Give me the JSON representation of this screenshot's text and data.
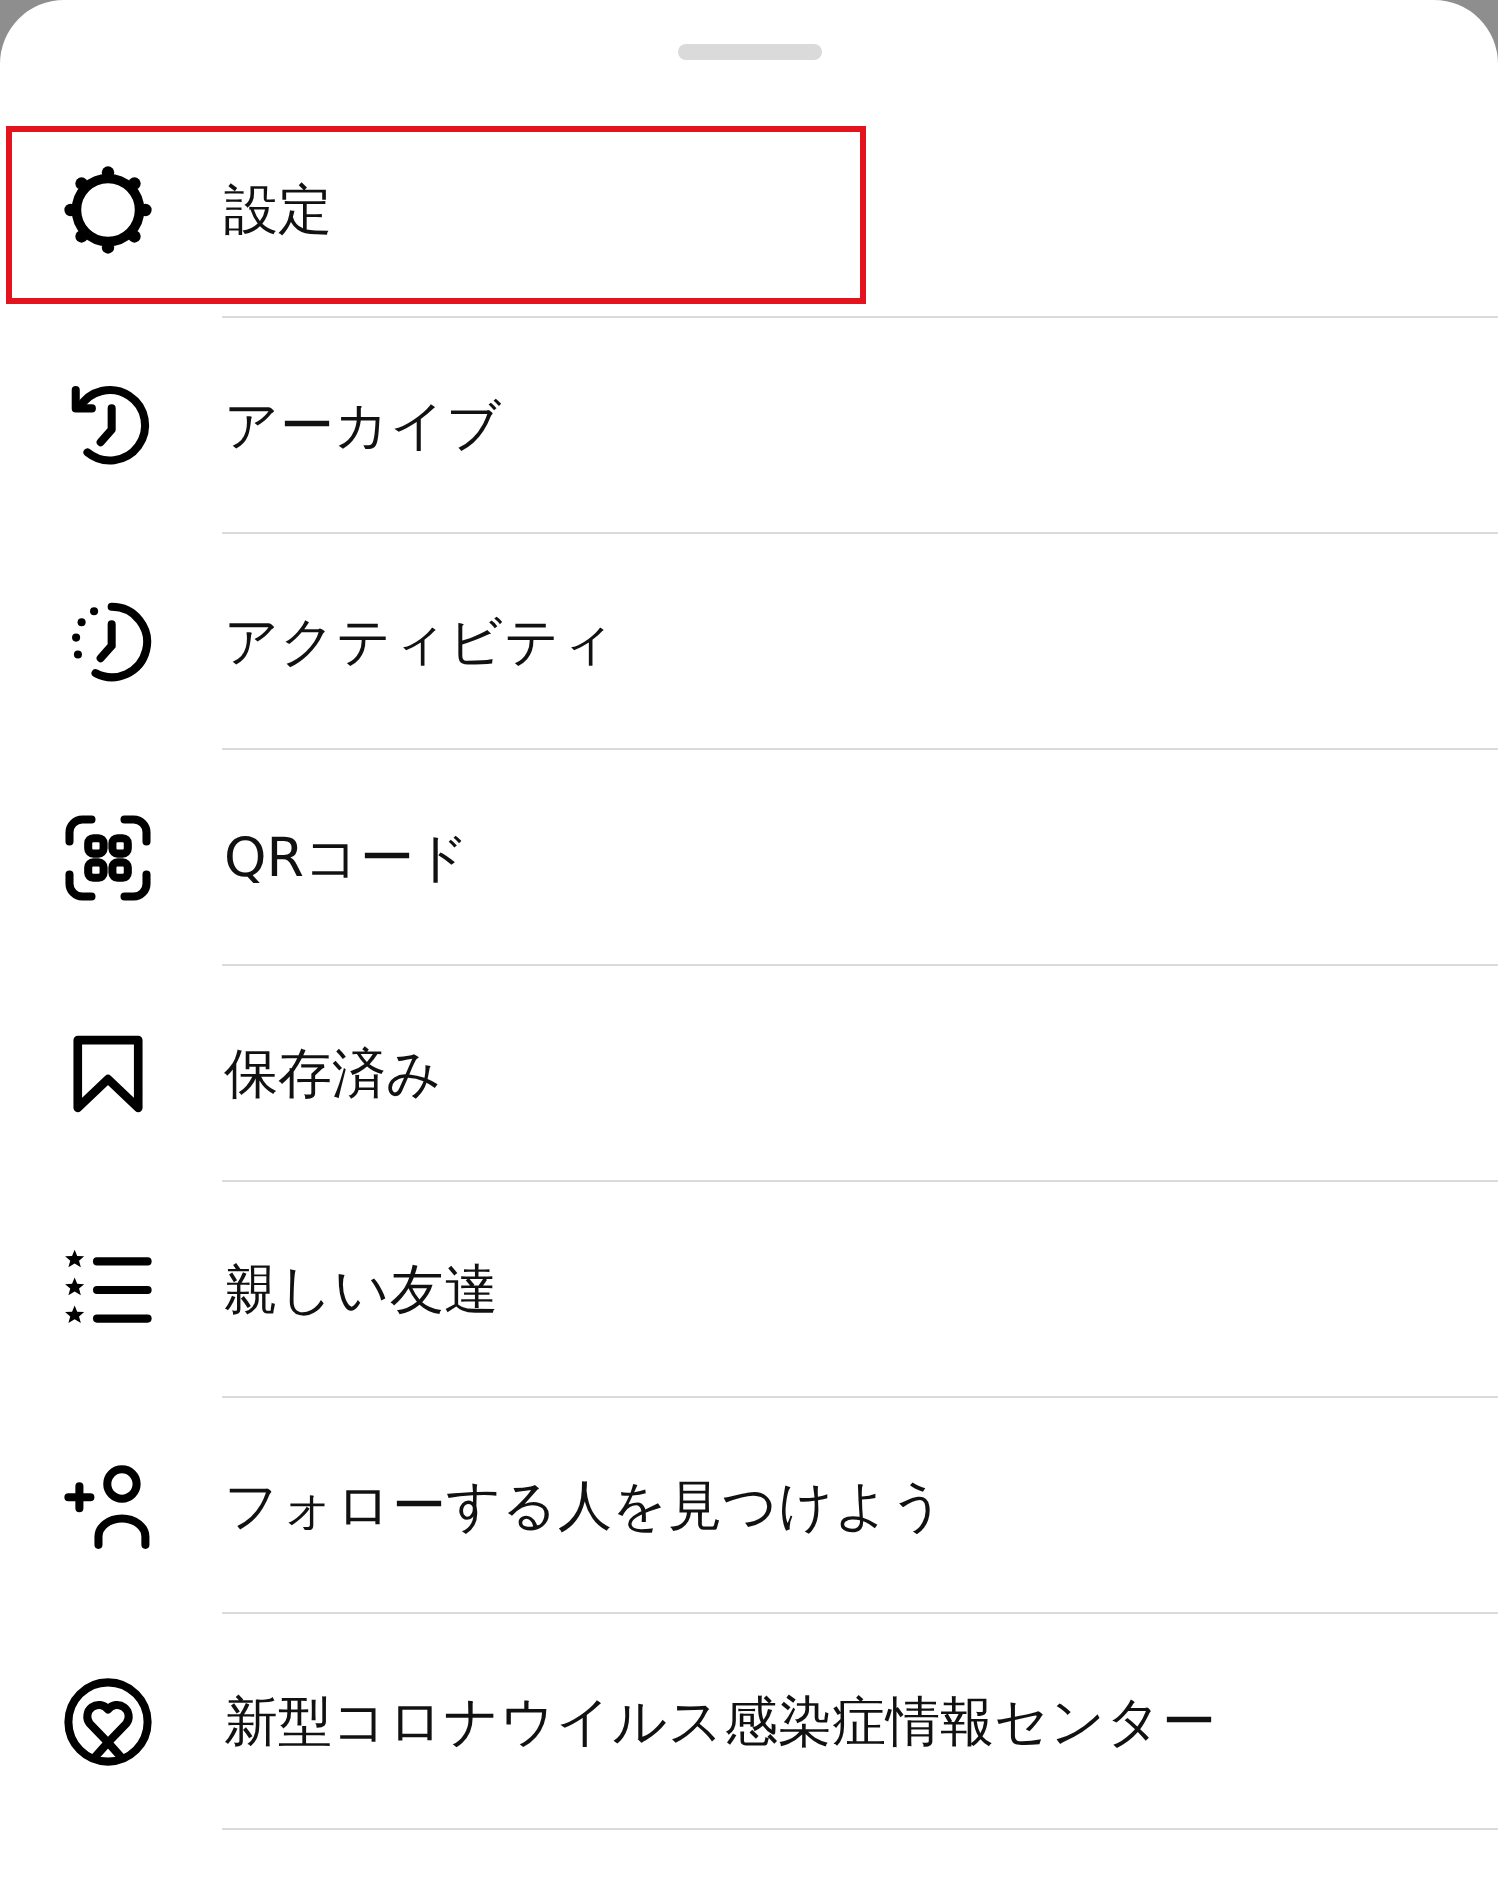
{
  "menu": {
    "items": [
      {
        "label": "設定",
        "highlighted": true
      },
      {
        "label": "アーカイブ",
        "highlighted": false
      },
      {
        "label": "アクティビティ",
        "highlighted": false
      },
      {
        "label": "QRコード",
        "highlighted": false
      },
      {
        "label": "保存済み",
        "highlighted": false
      },
      {
        "label": "親しい友達",
        "highlighted": false
      },
      {
        "label": "フォローする人を見つけよう",
        "highlighted": false
      },
      {
        "label": "新型コロナウイルス感染症情報センター",
        "highlighted": false
      }
    ]
  }
}
